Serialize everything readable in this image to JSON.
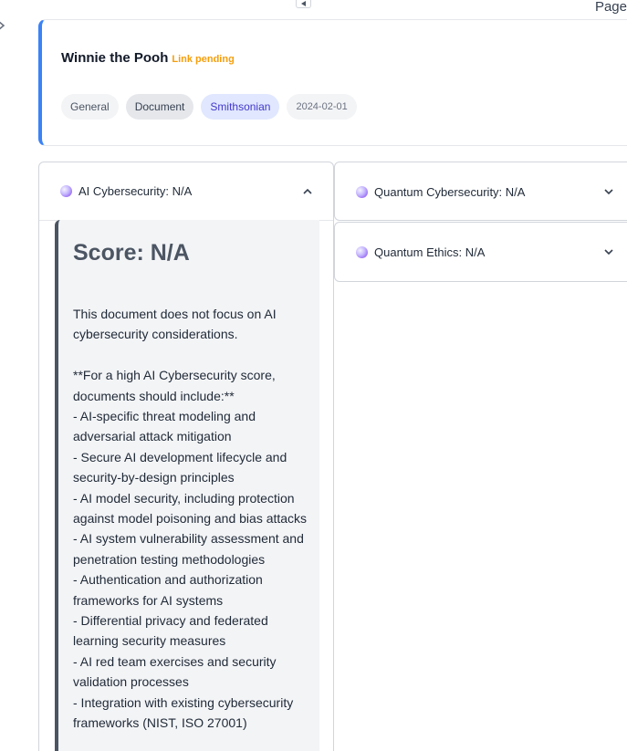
{
  "top": {
    "page_label": "Page"
  },
  "document": {
    "title": "Winnie the Pooh",
    "status": "Link pending",
    "tags": {
      "category": "General",
      "type": "Document",
      "source": "Smithsonian",
      "date": "2024-02-01"
    }
  },
  "colors": {
    "accent": "#3b82f6",
    "status": "#f59e0b",
    "source_tag": "#4338ca"
  },
  "sections": {
    "ai_cybersecurity": {
      "label": "AI Cybersecurity: N/A",
      "expanded": true,
      "score_title": "Score: N/A",
      "summary": "This document does not focus on AI cybersecurity considerations.",
      "criteria_heading": "**For a high AI Cybersecurity score, documents should include:**",
      "criteria": [
        "- AI-specific threat modeling and adversarial attack mitigation",
        "- Secure AI development lifecycle and security-by-design principles",
        "- AI model security, including protection against model poisoning and bias attacks",
        "- AI system vulnerability assessment and penetration testing methodologies",
        "- Authentication and authorization frameworks for AI systems",
        "- Differential privacy and federated learning security measures",
        "- AI red team exercises and security validation processes",
        "- Integration with existing cybersecurity frameworks (NIST, ISO 27001)"
      ]
    },
    "quantum_cybersecurity": {
      "label": "Quantum Cybersecurity: N/A",
      "expanded": false
    },
    "quantum_ethics": {
      "label": "Quantum Ethics: N/A",
      "expanded": false
    }
  },
  "icons": {
    "section_marker": "orb-icon",
    "expanded": "chevron-up-icon",
    "collapsed": "chevron-down-icon"
  }
}
